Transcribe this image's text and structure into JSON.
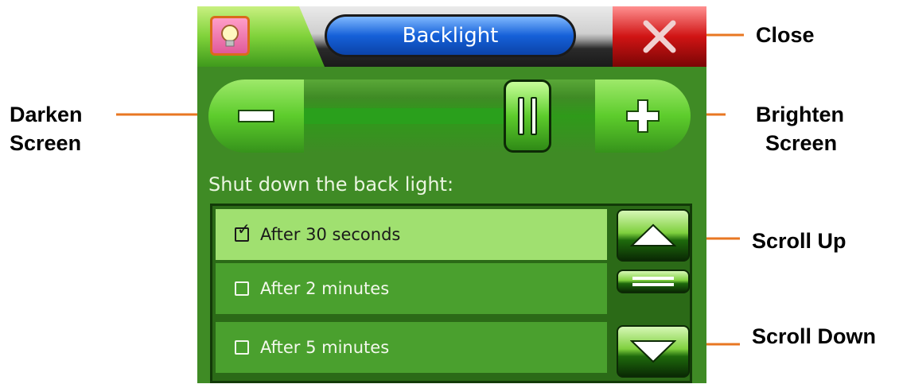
{
  "window": {
    "title": "Backlight",
    "icons": {
      "app": "lightbulb-icon",
      "close": "close-icon"
    }
  },
  "slider": {
    "icons": {
      "minus": "minus-icon",
      "plus": "plus-icon",
      "thumb": "slider-thumb-icon"
    },
    "level": 0.82
  },
  "section_label": "Shut down the back light:",
  "list": {
    "items": [
      {
        "label": "After 30 seconds",
        "checked": true
      },
      {
        "label": "After 2 minutes",
        "checked": false
      },
      {
        "label": "After 5 minutes",
        "checked": false
      }
    ],
    "scroll_icons": {
      "up": "arrow-up-icon",
      "down": "arrow-down-icon",
      "thumb": "scroll-thumb-icon"
    }
  },
  "annotations": {
    "close": "Close",
    "darken_line1": "Darken",
    "darken_line2": "Screen",
    "brighten_line1": "Brighten",
    "brighten_line2": "Screen",
    "scroll_up": "Scroll Up",
    "scroll_down": "Scroll Down"
  },
  "colors": {
    "arrow": "#e87722",
    "screen_bg": "#3f8b25",
    "selected_row": "#a0e070"
  }
}
